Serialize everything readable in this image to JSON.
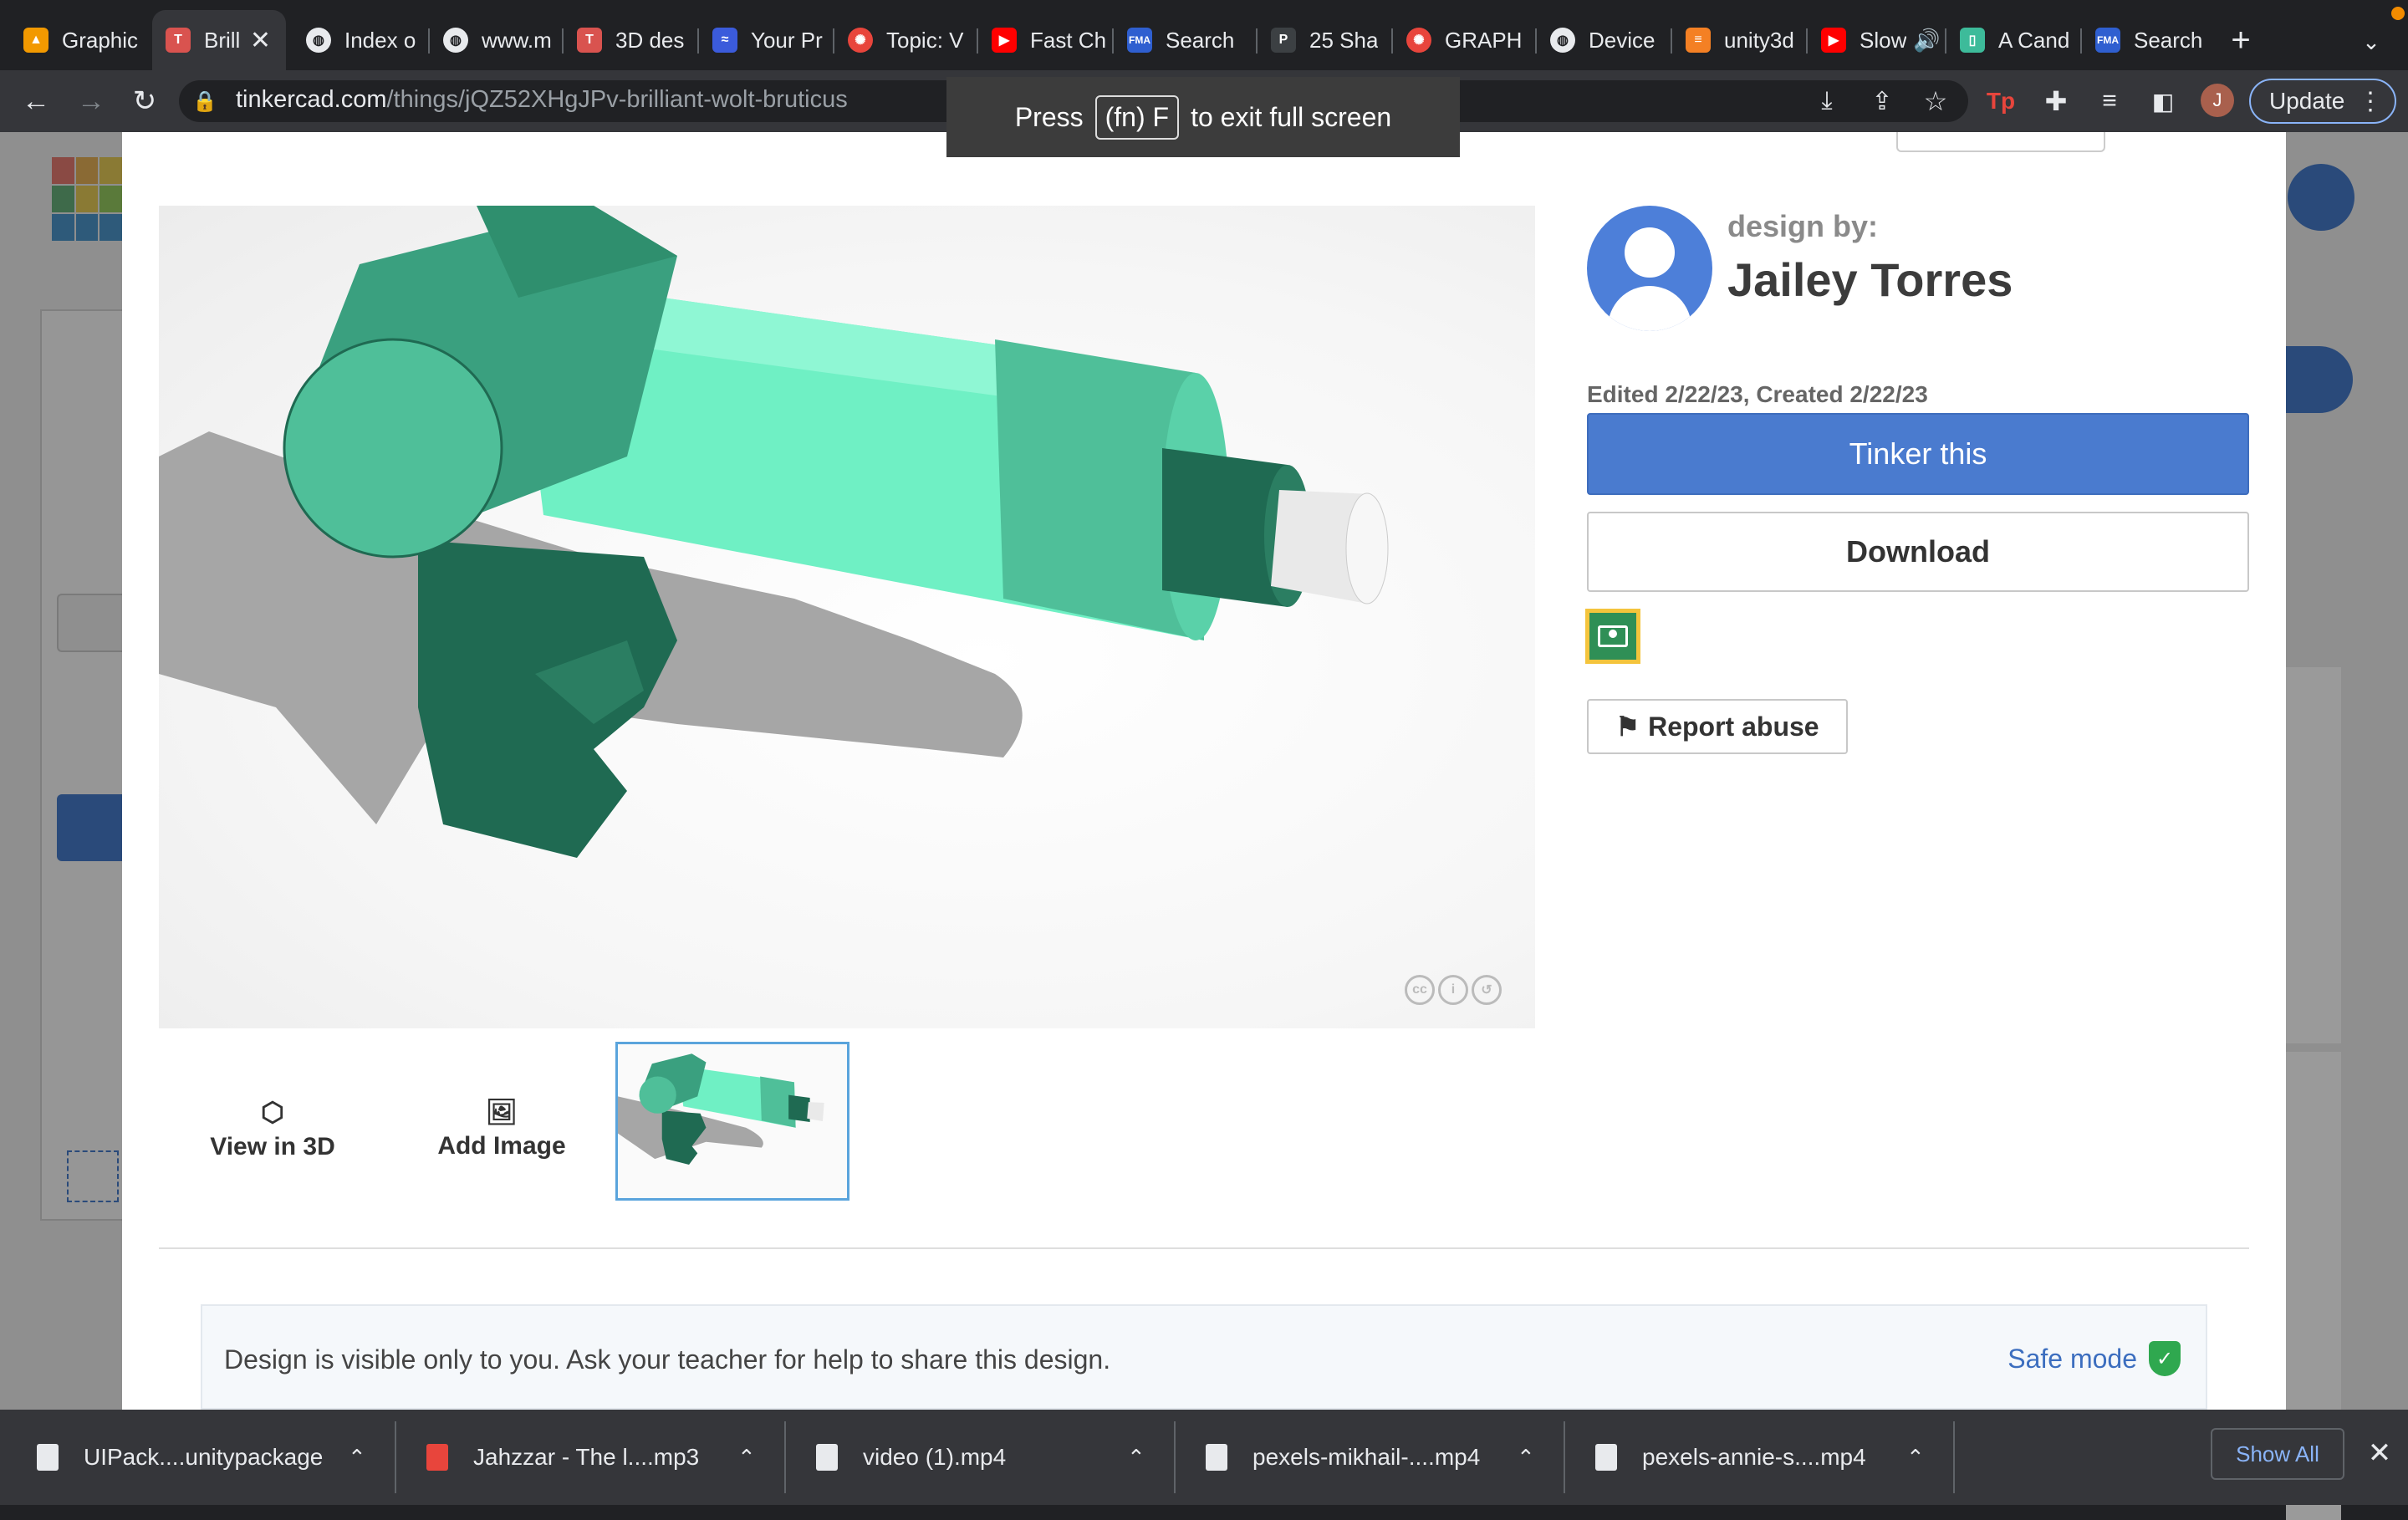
{
  "browser": {
    "tabs": [
      {
        "title": "Graphic",
        "favicon_color": "#f29900"
      },
      {
        "title": "Brill",
        "favicon_color": "#d9534f",
        "active": true
      },
      {
        "title": "Index o",
        "favicon_color": "#e8eaed"
      },
      {
        "title": "www.m",
        "favicon_color": "#e8eaed"
      },
      {
        "title": "3D des",
        "favicon_color": "#d9534f"
      },
      {
        "title": "Your Pr",
        "favicon_color": "#3b5bdb"
      },
      {
        "title": "Topic: V",
        "favicon_color": "#e8453c"
      },
      {
        "title": "Fast Ch",
        "favicon_color": "#ff0000"
      },
      {
        "title": "Search",
        "favicon_color": "#2f5fd0"
      },
      {
        "title": "25 Sha",
        "favicon_color": "#e8eaed"
      },
      {
        "title": "GRAPH",
        "favicon_color": "#e8453c"
      },
      {
        "title": "Device",
        "favicon_color": "#e8eaed"
      },
      {
        "title": "unity3d",
        "favicon_color": "#f48024"
      },
      {
        "title": "Slow",
        "favicon_color": "#ff0000"
      },
      {
        "title": "A Cand",
        "favicon_color": "#3dbb9a"
      },
      {
        "title": "Search",
        "favicon_color": "#2f5fd0"
      }
    ],
    "url_host": "tinkercad.com",
    "url_path": "/things/jQZ52XHgJPv-brilliant-wolt-bruticus",
    "profile_initial": "J",
    "update_label": "Update",
    "fullscreen_toast": {
      "before": "Press",
      "key": "(fn) F",
      "after": "to exit full screen"
    }
  },
  "modal": {
    "design_by_label": "design by:",
    "designer_name": "Jailey Torres",
    "dates": "Edited 2/22/23, Created 2/22/23",
    "tinker_label": "Tinker this",
    "download_label": "Download",
    "report_label": "Report abuse",
    "view3d_label": "View in 3D",
    "add_image_label": "Add Image",
    "notice_text": "Design is visible only to you. Ask your teacher for help to share this design.",
    "safe_mode_label": "Safe mode",
    "accent": "#4a7bcf",
    "gun_colors": {
      "light": "#6ff0c4",
      "mid": "#4fbf99",
      "dark": "#1f6a52",
      "tip": "#e9e9e9"
    }
  },
  "downloads": {
    "items": [
      {
        "name": "UIPack....unitypackage"
      },
      {
        "name": "Jahzzar - The l....mp3"
      },
      {
        "name": "video (1).mp4"
      },
      {
        "name": "pexels-mikhail-....mp4"
      },
      {
        "name": "pexels-annie-s....mp4"
      }
    ],
    "show_all_label": "Show All"
  }
}
